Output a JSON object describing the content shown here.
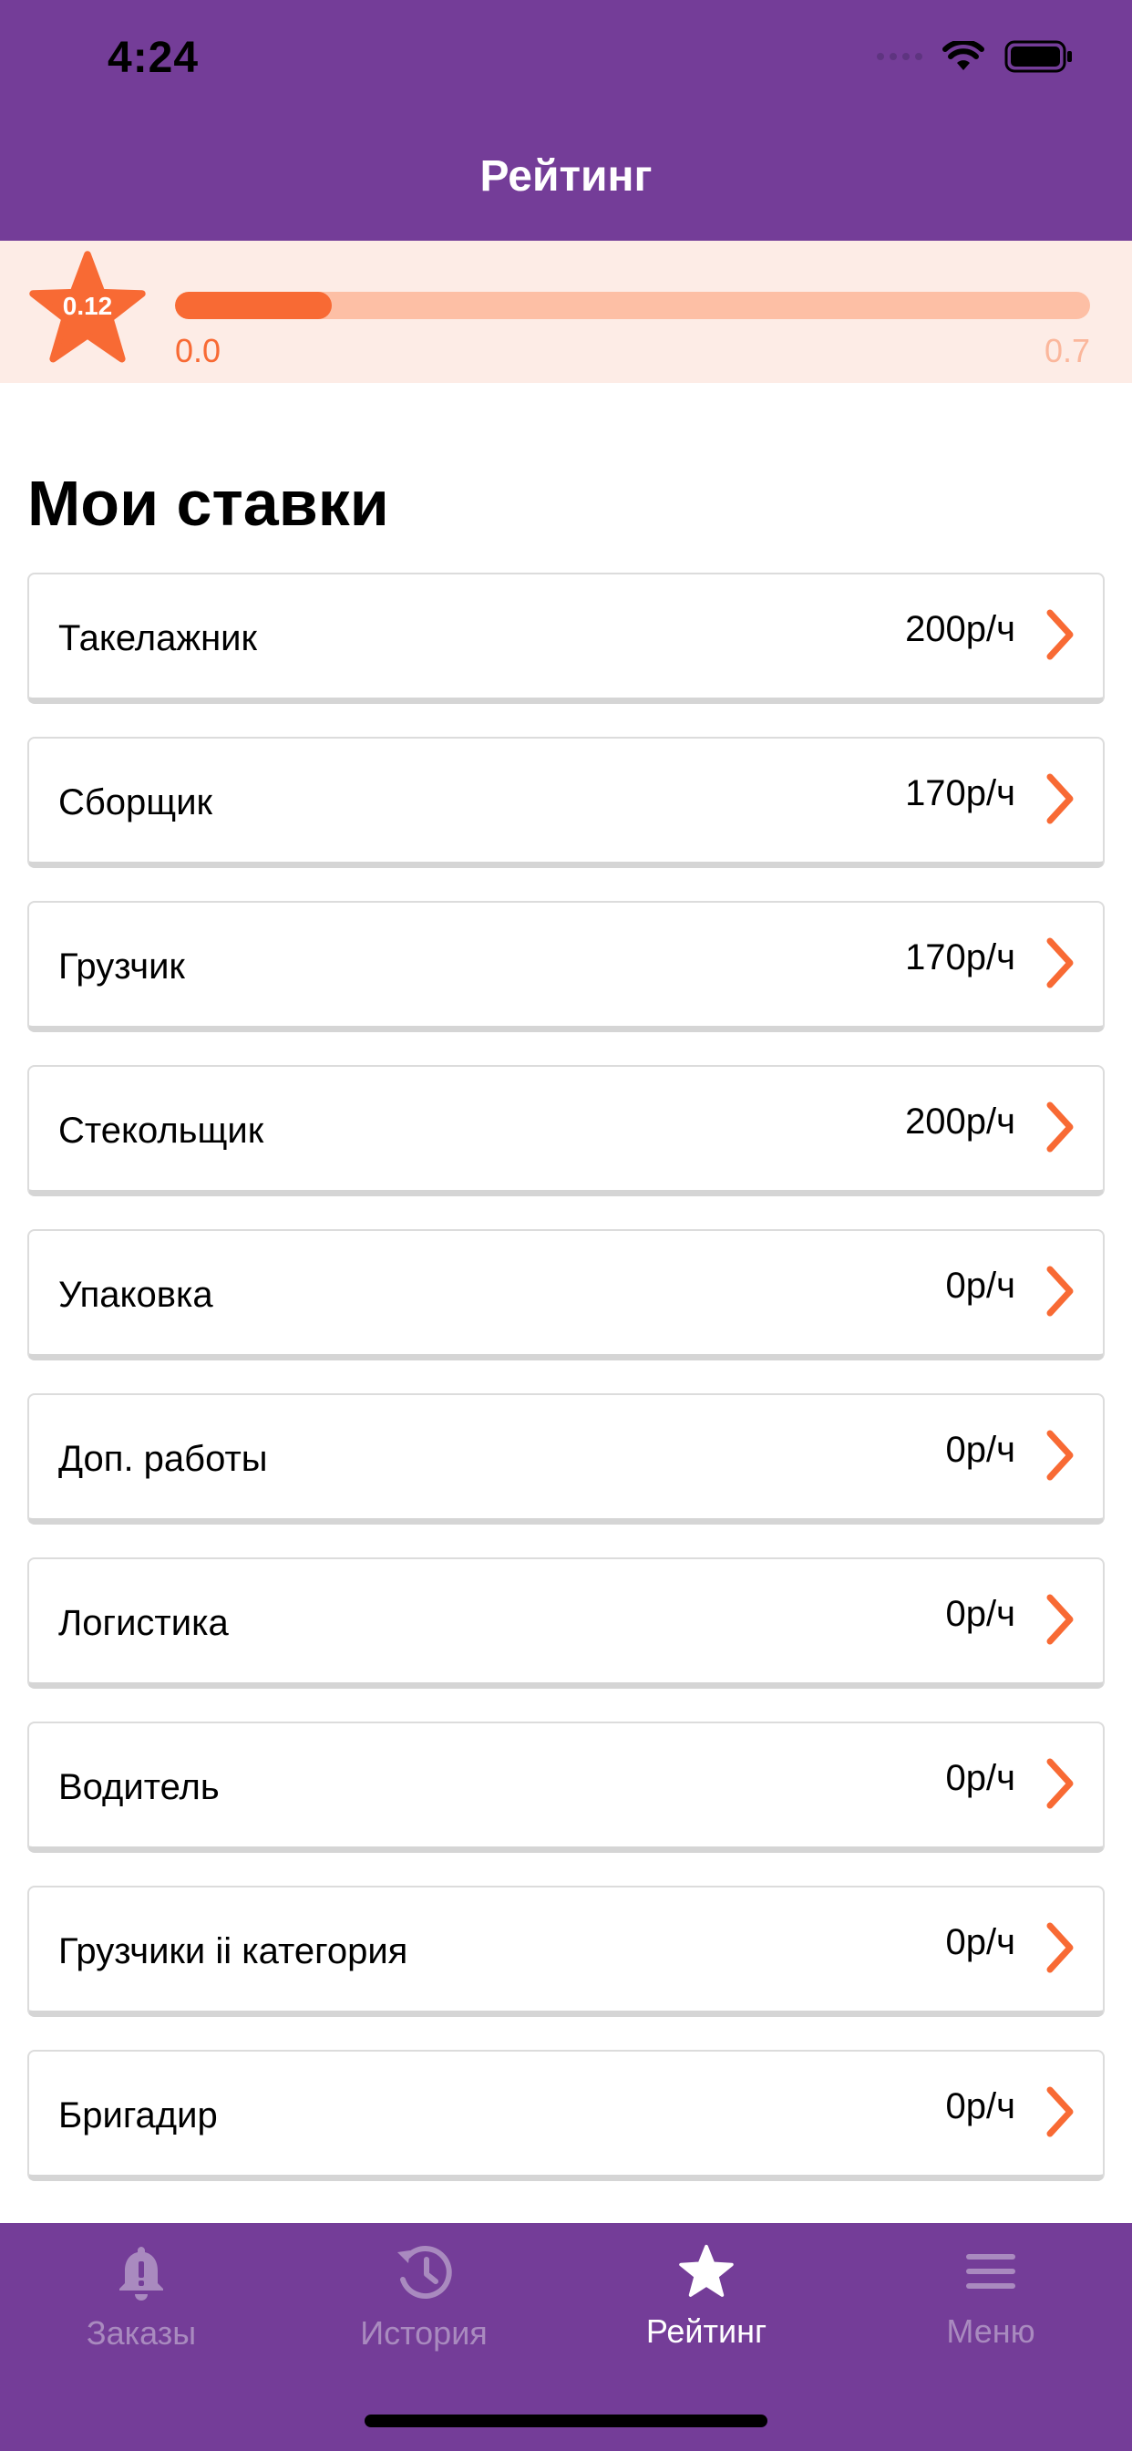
{
  "status_bar": {
    "time": "4:24",
    "icons": [
      "signal-dots-icon",
      "wifi-icon",
      "battery-icon"
    ]
  },
  "header": {
    "title": "Рейтинг"
  },
  "rating": {
    "value": "0.12",
    "min_label": "0.0",
    "max_label": "0.7",
    "progress_fraction": 0.171,
    "colors": {
      "fill": "#f86a34",
      "track": "#fdbfa5",
      "strip_bg": "#fdece6"
    }
  },
  "rates": {
    "title": "Мои ставки",
    "items": [
      {
        "name": "Такелажник",
        "value": "200р/ч"
      },
      {
        "name": "Сборщик",
        "value": "170р/ч"
      },
      {
        "name": "Грузчик",
        "value": "170р/ч"
      },
      {
        "name": "Стекольщик",
        "value": "200р/ч"
      },
      {
        "name": "Упаковка",
        "value": "0р/ч"
      },
      {
        "name": "Доп. работы",
        "value": "0р/ч"
      },
      {
        "name": "Логистика",
        "value": "0р/ч"
      },
      {
        "name": "Водитель",
        "value": "0р/ч"
      },
      {
        "name": "Грузчики ii категория",
        "value": "0р/ч"
      },
      {
        "name": "Бригадир",
        "value": "0р/ч"
      }
    ]
  },
  "tabbar": {
    "tabs": [
      {
        "label": "Заказы",
        "icon": "bell-icon",
        "active": false
      },
      {
        "label": "История",
        "icon": "history-icon",
        "active": false
      },
      {
        "label": "Рейтинг",
        "icon": "star-icon",
        "active": true
      },
      {
        "label": "Меню",
        "icon": "menu-icon",
        "active": false
      }
    ],
    "colors": {
      "background": "#743d98",
      "active": "#ffffff",
      "inactive": "#a98abf"
    }
  },
  "colors": {
    "brand_purple": "#743d98",
    "accent_orange": "#f86a34"
  }
}
